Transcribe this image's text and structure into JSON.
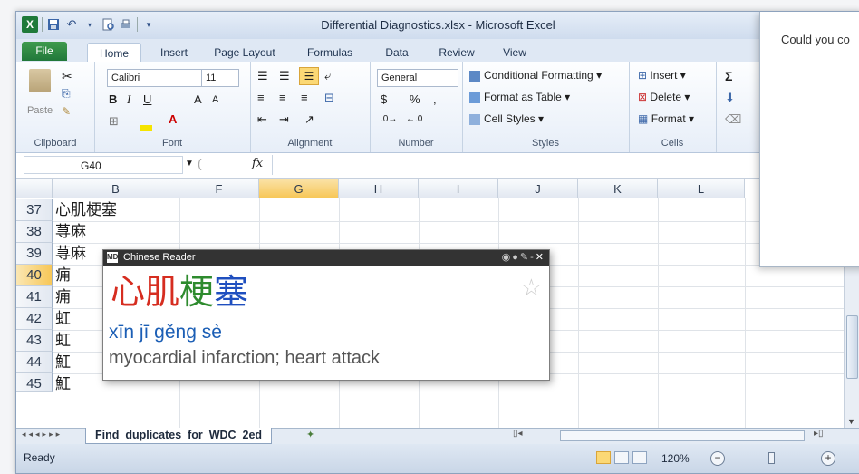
{
  "window": {
    "title": "Differential Diagnostics.xlsx - Microsoft Excel"
  },
  "tabs": [
    "File",
    "Home",
    "Insert",
    "Page Layout",
    "Formulas",
    "Data",
    "Review",
    "View"
  ],
  "ribbon": {
    "clipboard": {
      "label": "Clipboard",
      "paste": "Paste"
    },
    "font": {
      "label": "Font",
      "name": "Calibri",
      "size": "11"
    },
    "alignment": {
      "label": "Alignment"
    },
    "number": {
      "label": "Number",
      "format": "General",
      "currency": "$",
      "percent": "%",
      "comma": ","
    },
    "styles": {
      "label": "Styles",
      "conditional": "Conditional Formatting",
      "table": "Format as Table",
      "cell": "Cell Styles"
    },
    "cells": {
      "label": "Cells",
      "insert": "Insert",
      "delete": "Delete",
      "format": "Format"
    }
  },
  "formula_bar": {
    "name_box": "G40",
    "fx": "fx",
    "value": ""
  },
  "columns": [
    "B",
    "F",
    "G",
    "H",
    "I",
    "J",
    "K",
    "L"
  ],
  "selected_column": "G",
  "rows": [
    {
      "num": "37",
      "value": "心肌梗塞"
    },
    {
      "num": "38",
      "value": "荨麻"
    },
    {
      "num": "39",
      "value": "荨麻"
    },
    {
      "num": "40",
      "value": "痈"
    },
    {
      "num": "41",
      "value": "痈"
    },
    {
      "num": "42",
      "value": "虹"
    },
    {
      "num": "43",
      "value": "虹"
    },
    {
      "num": "44",
      "value": "魟"
    },
    {
      "num": "45",
      "value": "魟"
    }
  ],
  "selected_row": "40",
  "sheet_tab": "Find_duplicates_for_WDC_2ed",
  "status": {
    "ready": "Ready",
    "zoom": "120%"
  },
  "dialog": {
    "text": "Could you co"
  },
  "reader": {
    "app_name": "Chinese Reader",
    "logo": "MD",
    "chars": [
      {
        "ch": "心",
        "color": "#d62d20"
      },
      {
        "ch": "肌",
        "color": "#d62d20"
      },
      {
        "ch": "梗",
        "color": "#2e8b2e"
      },
      {
        "ch": "塞",
        "color": "#1f4fbf"
      }
    ],
    "pinyin": "xīn jī gěng sè",
    "definition": "myocardial infarction; heart attack"
  }
}
